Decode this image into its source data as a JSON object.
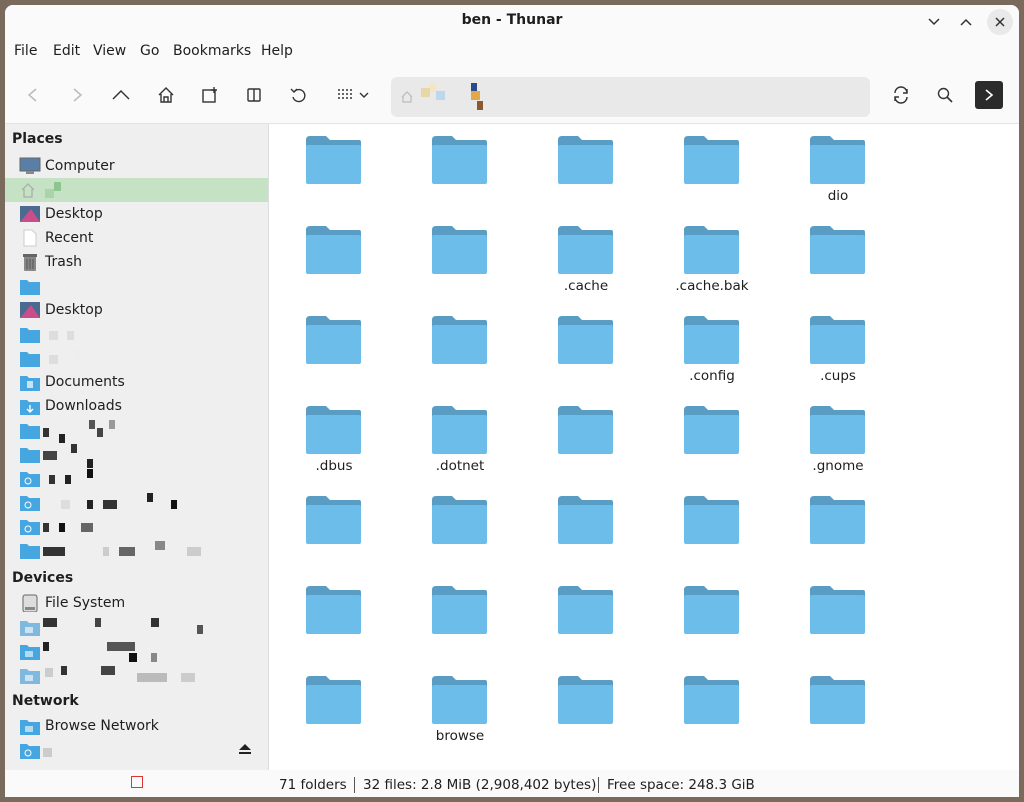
{
  "window": {
    "title": "ben - Thunar"
  },
  "menu": [
    "File",
    "Edit",
    "View",
    "Go",
    "Bookmarks",
    "Help"
  ],
  "sidebar": {
    "places_header": "Places",
    "devices_header": "Devices",
    "network_header": "Network",
    "items": {
      "computer": "Computer",
      "desktop": "Desktop",
      "recent": "Recent",
      "trash": "Trash",
      "desktop2": "Desktop",
      "documents": "Documents",
      "downloads": "Downloads",
      "file_system": "File System",
      "browse_network": "Browse Network"
    }
  },
  "files": [
    "",
    "",
    "",
    "",
    "dio",
    "",
    "",
    ".cache",
    ".cache.bak",
    "",
    "",
    "",
    "",
    ".config",
    ".cups",
    ".dbus",
    ".dotnet",
    "",
    "",
    ".gnome",
    "",
    "",
    "",
    "",
    "",
    "",
    "",
    "",
    "",
    "",
    "",
    "browse",
    "",
    "",
    ""
  ],
  "status": {
    "folders": "71 folders",
    "files": "32 files: 2.8 MiB (2,908,402 bytes)",
    "free": "Free space: 248.3 GiB"
  },
  "colors": {
    "folder": "#6cbde9",
    "folder_tab": "#5a9dc4",
    "selected": "#c5e3c4"
  }
}
